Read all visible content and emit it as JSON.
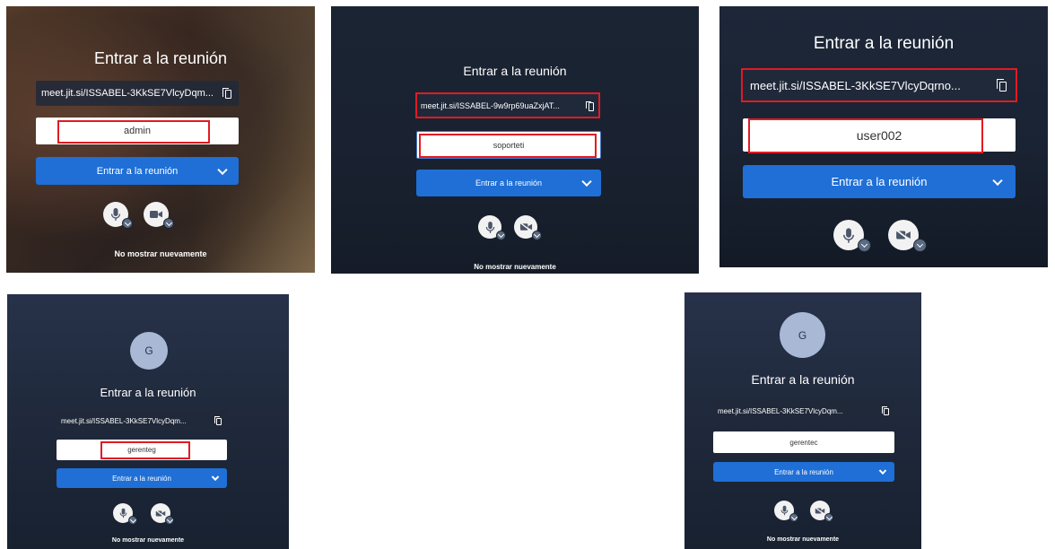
{
  "screens": {
    "admin": {
      "title": "Entrar a la reunión",
      "url": "meet.jit.si/ISSABEL-3KkSE7VlcyDqm...",
      "name_value": "admin",
      "join_label": "Entrar a la reunión",
      "no_show_label": "No mostrar nuevamente"
    },
    "soporteti": {
      "title": "Entrar a la reunión",
      "url": "meet.jit.si/ISSABEL-9w9rp69uaZxjAT...",
      "name_value": "soporteti",
      "join_label": "Entrar a la reunión",
      "no_show_label": "No mostrar nuevamente"
    },
    "user002": {
      "title": "Entrar a la reunión",
      "url": "meet.jit.si/ISSABEL-3KkSE7VlcyDqrno...",
      "name_value": "user002",
      "join_label": "Entrar a la reunión"
    },
    "gerenteg": {
      "avatar_letter": "G",
      "title": "Entrar a la reunión",
      "url": "meet.jit.si/ISSABEL-3KkSE7VlcyDqm...",
      "name_value": "gerenteg",
      "join_label": "Entrar a la reunión",
      "no_show_label": "No mostrar nuevamente"
    },
    "gerentec": {
      "avatar_letter": "G",
      "title": "Entrar a la reunión",
      "url": "meet.jit.si/ISSABEL-3KkSE7VlcyDqm...",
      "name_value": "gerentec",
      "join_label": "Entrar a la reunión",
      "no_show_label": "No mostrar nuevamente"
    }
  },
  "colors": {
    "panel_bg": "#1c2738",
    "join_button": "#1f6fd6",
    "highlight_border": "#e11b22"
  },
  "icons": [
    "copy-icon",
    "microphone-icon",
    "camera-icon",
    "camera-off-icon",
    "chevron-down-icon"
  ]
}
